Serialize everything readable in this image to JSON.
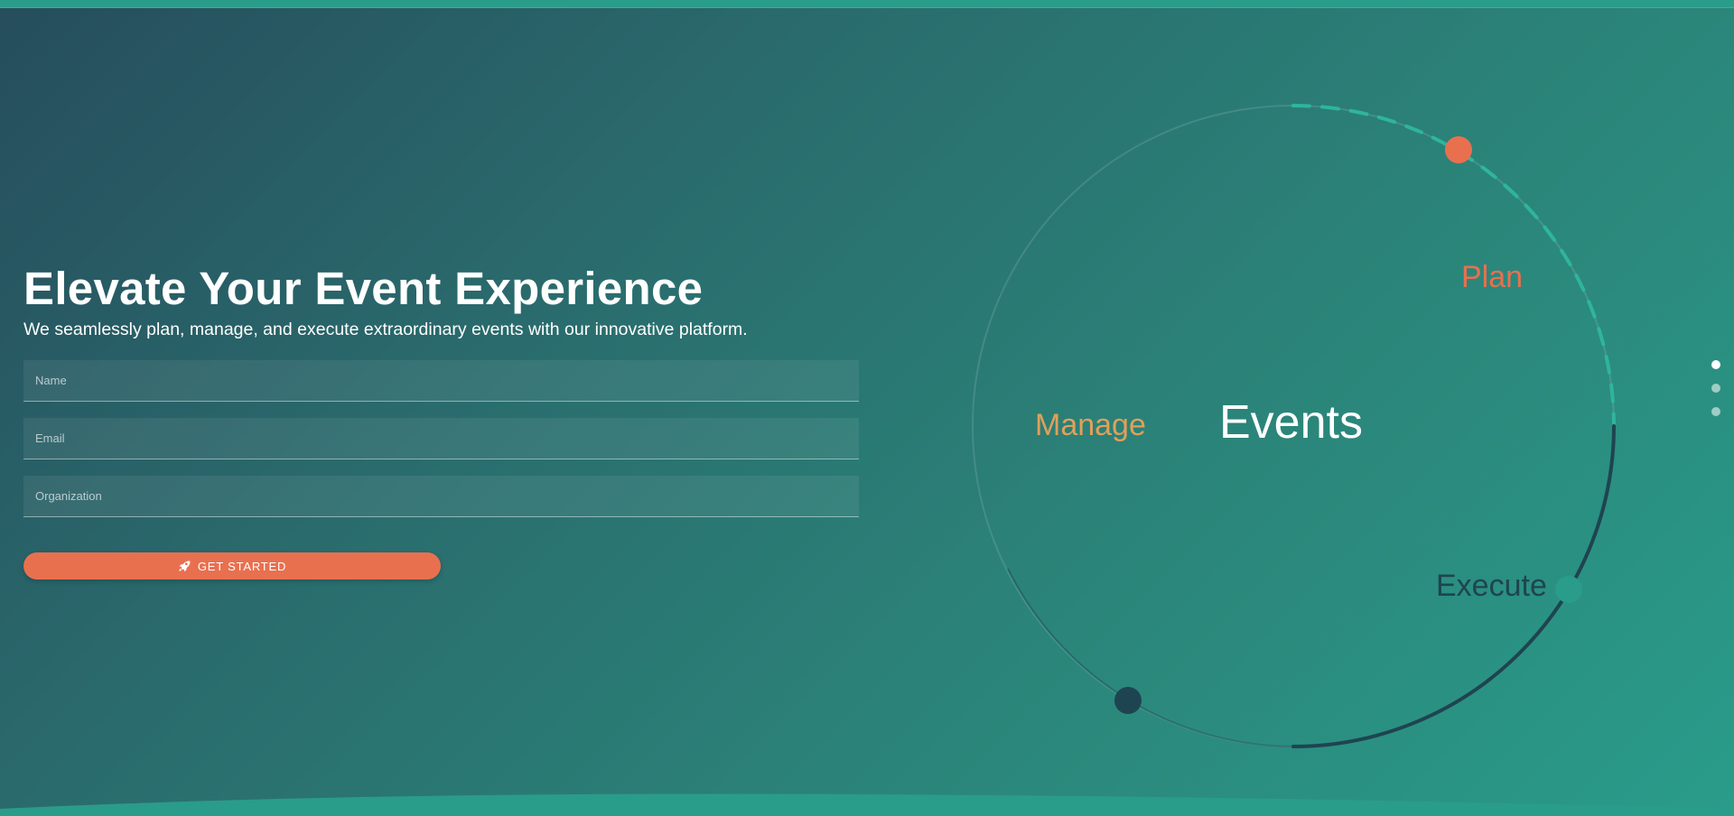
{
  "hero": {
    "title": "Elevate Your Event Experience",
    "subtitle": "We seamlessly plan, manage, and execute extraordinary events with our innovative platform."
  },
  "form": {
    "name_placeholder": "Name",
    "name_value": "",
    "email_placeholder": "Email",
    "email_value": "",
    "organization_placeholder": "Organization",
    "organization_value": "",
    "submit_label": "GET STARTED",
    "submit_icon": "rocket-icon"
  },
  "diagram": {
    "center_label": "Events",
    "plan_label": "Plan",
    "manage_label": "Manage",
    "execute_label": "Execute"
  },
  "pagination": {
    "total": 3,
    "active_index": 0
  },
  "colors": {
    "accent": "#e8704f",
    "manage": "#e0a05a",
    "execute": "#1f4451",
    "teal": "#2a9c8a"
  }
}
